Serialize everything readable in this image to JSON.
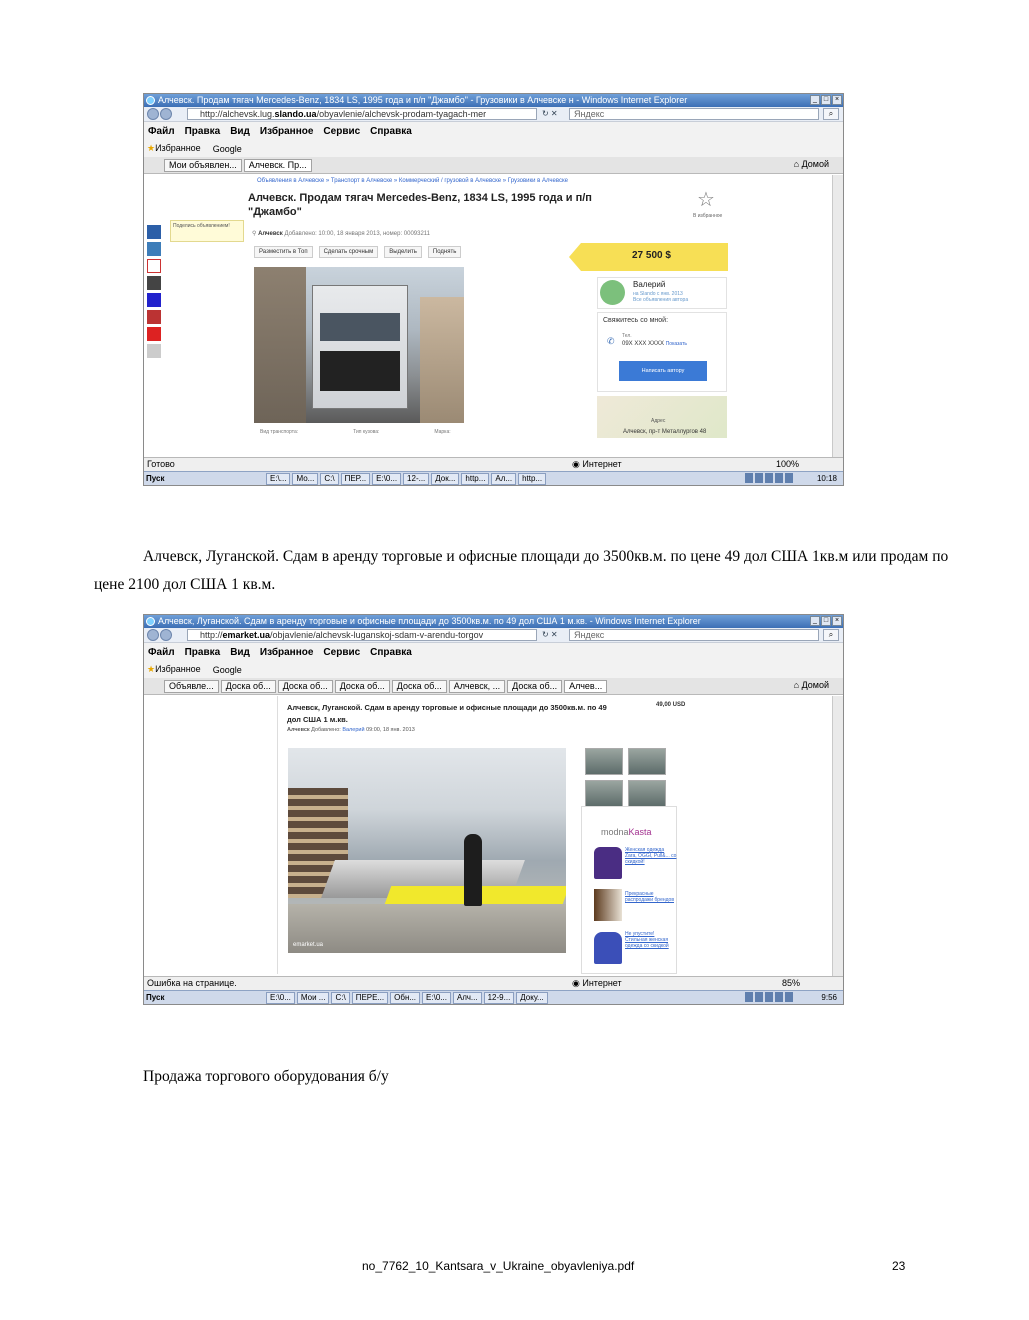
{
  "screenshot1": {
    "window_title": "Алчевск. Продам тягач Mercedes-Benz, 1834 LS, 1995 года и п/п \"Джамбо\" - Грузовики в Алчевске н - Windows Internet Explorer",
    "url_prefix": "http://alchevsk.lug.",
    "url_domain": "slando.ua",
    "url_path": "/obyavlenie/alchevsk-prodam-tyagach-mer",
    "search_placeholder": "Яндекс",
    "menu": [
      "Файл",
      "Правка",
      "Вид",
      "Избранное",
      "Сервис",
      "Справка"
    ],
    "favorites": [
      "Избранное",
      "Google"
    ],
    "tabs": [
      "Мои объявлен...",
      "Алчевск. Пр..."
    ],
    "home_label": "Домой",
    "page": {
      "breadcrumb": "Объявления в Алчевске » Транспорт в Алчевске » Коммерческий / грузовой в Алчевске » Грузовики в Алчевске",
      "share_tip": "Поделись объявлением!",
      "title": "Алчевск. Продам тягач Mercedes-Benz, 1834 LS, 1995 года и п/п \"Джамбо\"",
      "city": "Алчевск",
      "meta": "Добавлено: 10:00, 18 января 2013, номер: 00093211",
      "actions": [
        "Разместить в Топ",
        "Сделать срочным",
        "Выделить",
        "Поднять"
      ],
      "fav_label": "В избранное",
      "price": "27 500 $",
      "seller_name": "Валерий",
      "seller_since": "на Slando с янв. 2013",
      "seller_link": "Все объявления автора",
      "contact_heading": "Свяжитесь со мной:",
      "phone_label": "Тел.",
      "phone_value": "09X XXX XXXX",
      "phone_show": "Показать",
      "write_button": "Написать автору",
      "map_label": "Адрес",
      "map_address": "Алчевск, пр-т Металлургов 48",
      "specs": [
        "Вид транспорта:",
        "Тип кузова:",
        "Марка:"
      ]
    },
    "status_left": "Готово",
    "status_zone": "Интернет",
    "zoom": "100%",
    "taskbar_start": "Пуск",
    "taskbar_items": [
      "E:\\...",
      "Мо...",
      "C:\\",
      "ПЕР...",
      "E:\\0...",
      "12-...",
      "Док...",
      "http...",
      "Ал...",
      "http..."
    ],
    "clock": "10:18"
  },
  "paragraph1": "Алчевск, Луганской. Сдам в аренду торговые и офисные площади до 3500кв.м. по цене 49 дол США 1кв.м или продам по цене 2100 дол США 1 кв.м.",
  "screenshot2": {
    "window_title": "Алчевск, Луганской. Сдам в аренду торговые и офисные площади до 3500кв.м. по 49 дол США 1 м.кв. - Windows Internet Explorer",
    "url_prefix": "http://",
    "url_domain": "emarket.ua",
    "url_path": "/objavlenie/alchevsk-luganskoj-sdam-v-arendu-torgov",
    "search_placeholder": "Яндекс",
    "menu": [
      "Файл",
      "Правка",
      "Вид",
      "Избранное",
      "Сервис",
      "Справка"
    ],
    "favorites": [
      "Избранное",
      "Google"
    ],
    "tabs": [
      "Объявле...",
      "Доска об...",
      "Доска об...",
      "Доска об...",
      "Доска об...",
      "Алчевск, ...",
      "Доска об...",
      "Алчев..."
    ],
    "home_label": "Домой",
    "page": {
      "title": "Алчевск, Луганской. Сдам в аренду торговые и офисные площади до 3500кв.м. по 49 дол США 1 м.кв.",
      "price": "49,00 USD",
      "city": "Алчевск",
      "added": "Добавлено:",
      "author": "Валерий",
      "date": "09:00, 18 янв. 2013",
      "photo_caption": "emarket.ua",
      "brand_prefix": "modna",
      "brand_suffix": "Kasta",
      "products": [
        "Женская одежда Zara, OGGI, Pull&... со скидкой!",
        "Прекрасные распродажи брендов",
        "Не упустите! Стильная женская одежда со скидкой"
      ]
    },
    "status_left": "Ошибка на странице.",
    "status_zone": "Интернет",
    "zoom": "85%",
    "taskbar_start": "Пуск",
    "taskbar_items": [
      "E:\\0...",
      "Мои ...",
      "C:\\",
      "ПЕРЕ...",
      "Обн...",
      "E:\\0...",
      "Алч...",
      "12-9...",
      "Доку..."
    ],
    "clock": "9:56"
  },
  "paragraph2": "Продажа торгового оборудования б/у",
  "footer": {
    "filename": "no_7762_10_Kantsara_v_Ukraine_obyavleniya.pdf",
    "page_number": "23"
  }
}
